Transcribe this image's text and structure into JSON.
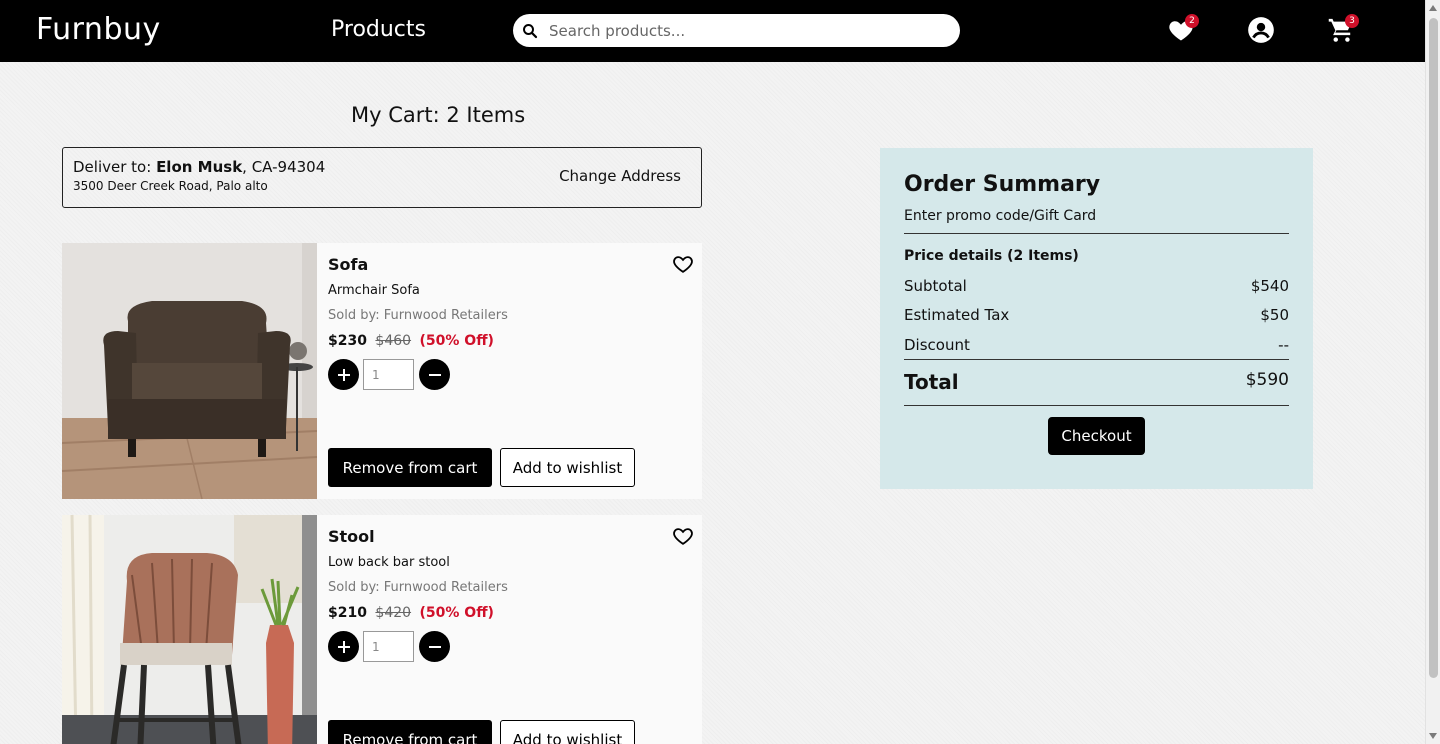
{
  "header": {
    "brand": "Furnbuy",
    "nav_products": "Products",
    "search_placeholder": "Search products...",
    "wishlist_count": "2",
    "cart_count": "3"
  },
  "cart": {
    "title": "My Cart: 2 Items",
    "address": {
      "label": "Deliver to:",
      "name": "Elon Musk",
      "zip": ", CA-94304",
      "street": "3500 Deer Creek Road, Palo alto",
      "change_label": "Change Address"
    },
    "items": [
      {
        "name": "Sofa",
        "description": "Armchair Sofa",
        "seller": "Sold by: Furnwood Retailers",
        "price": "$230",
        "old_price": "$460",
        "discount": "(50% Off)",
        "quantity": "1",
        "remove_label": "Remove from cart",
        "wishlist_label": "Add to wishlist"
      },
      {
        "name": "Stool",
        "description": "Low back bar stool",
        "seller": "Sold by: Furnwood Retailers",
        "price": "$210",
        "old_price": "$420",
        "discount": "(50% Off)",
        "quantity": "1",
        "remove_label": "Remove from cart",
        "wishlist_label": "Add to wishlist"
      }
    ]
  },
  "summary": {
    "title": "Order Summary",
    "promo": "Enter promo code/Gift Card",
    "price_details": "Price details (2 Items)",
    "subtotal_label": "Subtotal",
    "subtotal": "$540",
    "tax_label": "Estimated Tax",
    "tax": "$50",
    "discount_label": "Discount",
    "discount": "--",
    "total_label": "Total",
    "total": "$590",
    "checkout_label": "Checkout"
  },
  "colors": {
    "header_bg": "#000000",
    "summary_bg": "#d5e8ea",
    "discount_red": "#d0102a",
    "badge_red": "#d0102a"
  }
}
